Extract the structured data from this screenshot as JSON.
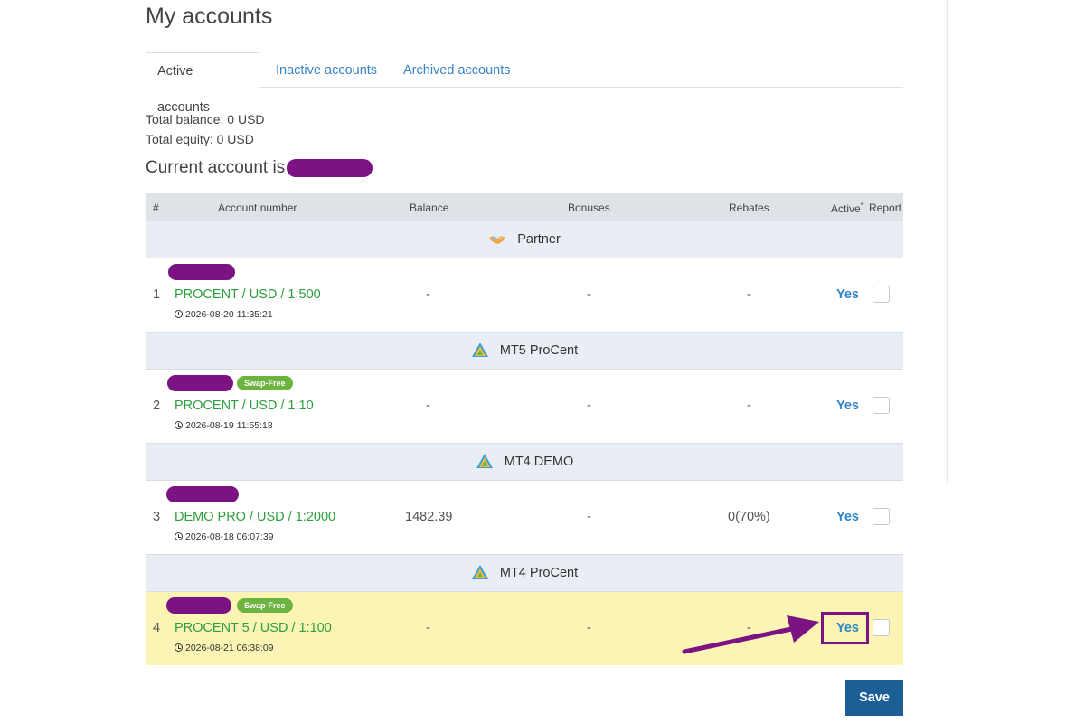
{
  "page": {
    "title": "My accounts"
  },
  "tabs": [
    {
      "label": "Active accounts",
      "active": true
    },
    {
      "label": "Inactive accounts",
      "active": false
    },
    {
      "label": "Archived accounts",
      "active": false
    }
  ],
  "totals": {
    "balance": "Total balance: 0 USD",
    "equity": "Total equity: 0 USD"
  },
  "current_account_label": "Current account is",
  "table": {
    "headers": {
      "num": "#",
      "account_number": "Account number",
      "balance": "Balance",
      "bonuses": "Bonuses",
      "rebates": "Rebates",
      "active": "Active",
      "active_mark": "*",
      "report": "Report"
    },
    "groups": [
      {
        "name": "Partner",
        "icon": "handshake-icon",
        "rows": [
          {
            "num": "1",
            "type": "PROCENT / USD / 1:500",
            "date": "2026-08-20 11:35:21",
            "balance": "-",
            "bonuses": "-",
            "rebates": "-",
            "active": "Yes",
            "swap_free": ""
          }
        ]
      },
      {
        "name": "MT5 ProCent",
        "icon": "metatrader-icon",
        "rows": [
          {
            "num": "2",
            "type": "PROCENT / USD / 1:10",
            "date": "2026-08-19 11:55:18",
            "balance": "-",
            "bonuses": "-",
            "rebates": "-",
            "active": "Yes",
            "swap_free": "Swap-Free"
          }
        ]
      },
      {
        "name": "MT4 DEMO",
        "icon": "metatrader-icon",
        "rows": [
          {
            "num": "3",
            "type": "DEMO PRO / USD / 1:2000",
            "date": "2026-08-18 06:07:39",
            "balance": "1482.39",
            "bonuses": "-",
            "rebates": "0(70%)",
            "active": "Yes",
            "swap_free": ""
          }
        ]
      },
      {
        "name": "MT4 ProCent",
        "icon": "metatrader-icon",
        "rows": [
          {
            "num": "4",
            "type": "PROCENT 5 / USD / 1:100",
            "date": "2026-08-21 06:38:09",
            "balance": "-",
            "bonuses": "-",
            "rebates": "-",
            "active": "Yes",
            "swap_free": "Swap-Free"
          }
        ]
      }
    ]
  },
  "save_label": "Save",
  "colors": {
    "accent_link": "#3a84c6",
    "account_green": "#2c9f3c",
    "redaction_purple": "#7c1382",
    "save_button": "#1c5e96",
    "highlight_row": "#fbf4b4",
    "swap_free_badge": "#6db33f"
  }
}
